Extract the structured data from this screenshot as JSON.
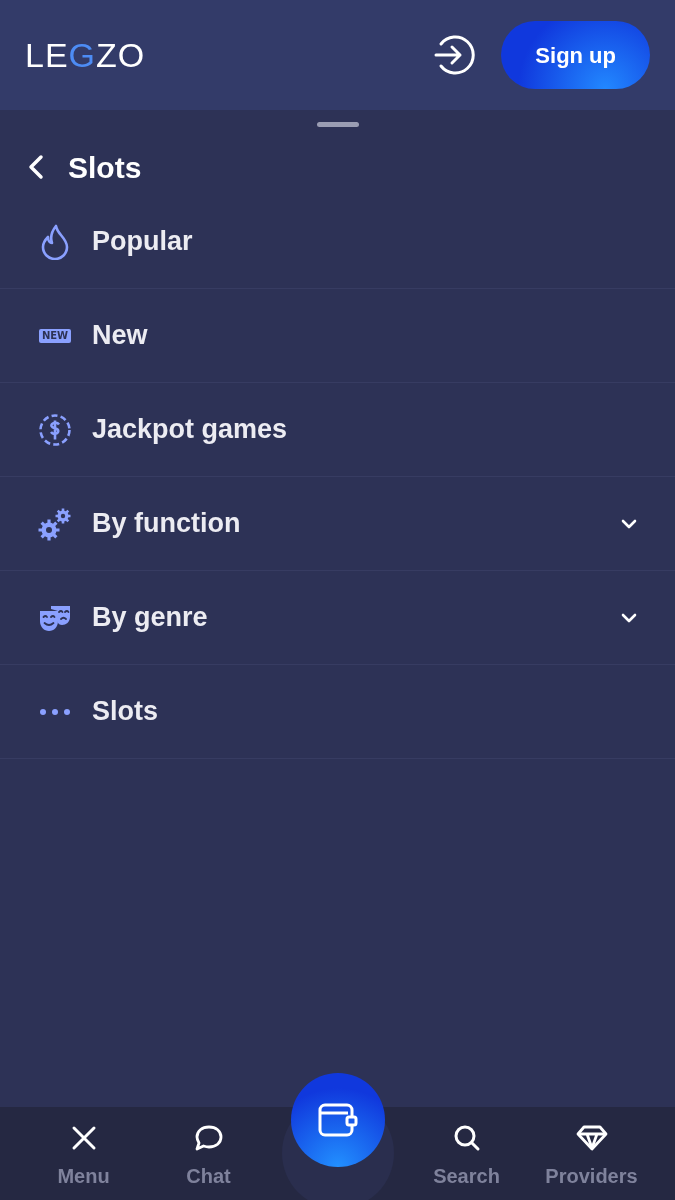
{
  "header": {
    "logo": {
      "before": "LE",
      "accent": "G",
      "after": "ZO"
    },
    "signup_button": "Sign up"
  },
  "panel": {
    "title": "Slots",
    "items": [
      {
        "label": "Popular",
        "kind": "flame",
        "expandable": false
      },
      {
        "label": "New",
        "kind": "badge",
        "badge": "NEW",
        "expandable": false
      },
      {
        "label": "Jackpot games",
        "kind": "coin",
        "expandable": false
      },
      {
        "label": "By function",
        "kind": "gears",
        "expandable": true
      },
      {
        "label": "By genre",
        "kind": "masks",
        "expandable": true
      },
      {
        "label": "Slots",
        "kind": "dots",
        "expandable": false
      }
    ]
  },
  "bottom_nav": [
    {
      "label": "Menu",
      "kind": "close"
    },
    {
      "label": "Chat",
      "kind": "chat"
    },
    {
      "label": "Search",
      "kind": "search"
    },
    {
      "label": "Providers",
      "kind": "diamond"
    }
  ]
}
